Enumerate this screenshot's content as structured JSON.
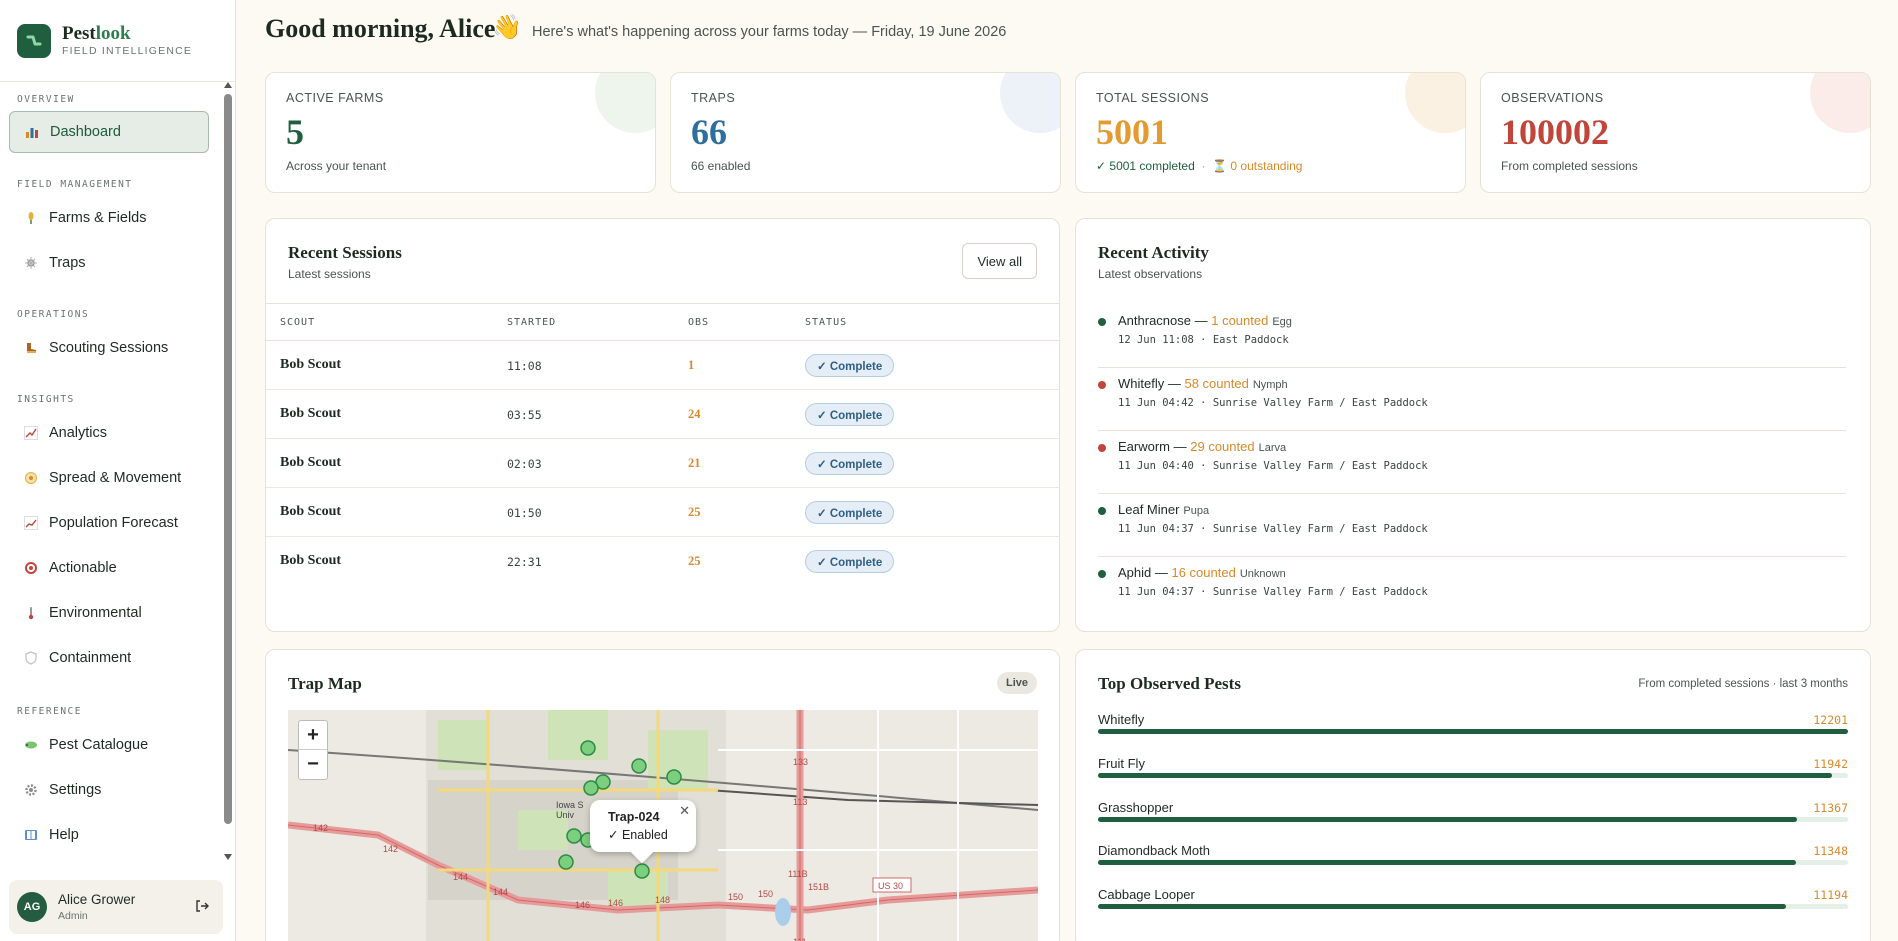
{
  "brand": {
    "name_prefix": "Pest",
    "name_suffix": "look",
    "subtitle": "FIELD INTELLIGENCE"
  },
  "sidebar": {
    "sections": [
      {
        "title": "OVERVIEW"
      },
      {
        "title": "FIELD MANAGEMENT"
      },
      {
        "title": "OPERATIONS"
      },
      {
        "title": "INSIGHTS"
      },
      {
        "title": "REFERENCE"
      }
    ],
    "items": [
      {
        "label": "Dashboard",
        "icon": "bar-chart-icon",
        "active": true
      },
      {
        "label": "Farms & Fields",
        "icon": "crop-icon"
      },
      {
        "label": "Traps",
        "icon": "trap-icon"
      },
      {
        "label": "Scouting Sessions",
        "icon": "boot-icon"
      },
      {
        "label": "Analytics",
        "icon": "line-chart-icon"
      },
      {
        "label": "Spread & Movement",
        "icon": "spread-icon"
      },
      {
        "label": "Population Forecast",
        "icon": "forecast-icon"
      },
      {
        "label": "Actionable",
        "icon": "target-icon"
      },
      {
        "label": "Environmental",
        "icon": "thermometer-icon"
      },
      {
        "label": "Containment",
        "icon": "shield-icon"
      },
      {
        "label": "Pest Catalogue",
        "icon": "bug-icon"
      },
      {
        "label": "Settings",
        "icon": "gear-icon"
      },
      {
        "label": "Help",
        "icon": "book-icon"
      }
    ]
  },
  "user": {
    "initials": "AG",
    "name": "Alice Grower",
    "role": "Admin"
  },
  "header": {
    "greeting": "Good morning, Alice",
    "wave": "👋",
    "subtitle": "Here's what's happening across your farms today — Friday, 19 June 2026"
  },
  "stats": [
    {
      "label": "ACTIVE FARMS",
      "value": "5",
      "sub": "Across your tenant",
      "color": "#1f5e3f"
    },
    {
      "label": "TRAPS",
      "value": "66",
      "sub": "66 enabled",
      "color": "#2e6f9e"
    },
    {
      "label": "TOTAL SESSIONS",
      "value": "5001",
      "sub_completed": "✓ 5001 completed",
      "sub_sep": "·",
      "sub_outstanding": "⏳ 0 outstanding",
      "color": "#e39a2f"
    },
    {
      "label": "OBSERVATIONS",
      "value": "100002",
      "sub": "From completed sessions",
      "color": "#c0453a"
    }
  ],
  "recent_sessions": {
    "title": "Recent Sessions",
    "subtitle": "Latest sessions",
    "view_all": "View all",
    "columns": [
      "SCOUT",
      "STARTED",
      "OBS",
      "STATUS"
    ],
    "rows": [
      {
        "scout": "Bob Scout",
        "started": "11:08",
        "obs": "1",
        "status": "✓ Complete"
      },
      {
        "scout": "Bob Scout",
        "started": "03:55",
        "obs": "24",
        "status": "✓ Complete"
      },
      {
        "scout": "Bob Scout",
        "started": "02:03",
        "obs": "21",
        "status": "✓ Complete"
      },
      {
        "scout": "Bob Scout",
        "started": "01:50",
        "obs": "25",
        "status": "✓ Complete"
      },
      {
        "scout": "Bob Scout",
        "started": "22:31",
        "obs": "25",
        "status": "✓ Complete"
      }
    ]
  },
  "recent_activity": {
    "title": "Recent Activity",
    "subtitle": "Latest observations",
    "items": [
      {
        "pest": "Anthracnose",
        "dash": " — ",
        "count": "1 counted",
        "stage": "Egg",
        "meta": "12 Jun 11:08 · East Paddock",
        "dot": "#1f5e3f"
      },
      {
        "pest": "Whitefly",
        "dash": " — ",
        "count": "58 counted",
        "stage": "Nymph",
        "meta": "11 Jun 04:42 · Sunrise Valley Farm / East Paddock",
        "dot": "#c0453a"
      },
      {
        "pest": "Earworm",
        "dash": " — ",
        "count": "29 counted",
        "stage": "Larva",
        "meta": "11 Jun 04:40 · Sunrise Valley Farm / East Paddock",
        "dot": "#c0453a"
      },
      {
        "pest": "Leaf Miner",
        "dash": "",
        "count": "",
        "stage": "Pupa",
        "meta": "11 Jun 04:37 · Sunrise Valley Farm / East Paddock",
        "dot": "#1f5e3f"
      },
      {
        "pest": "Aphid",
        "dash": " — ",
        "count": "16 counted",
        "stage": "Unknown",
        "meta": "11 Jun 04:37 · Sunrise Valley Farm / East Paddock",
        "dot": "#1f5e3f"
      }
    ]
  },
  "trap_map": {
    "title": "Trap Map",
    "badge": "Live",
    "zoom_in": "+",
    "zoom_out": "−",
    "popup": {
      "title": "Trap-024",
      "status": "✓ Enabled",
      "close": "✕"
    },
    "map_labels": [
      "142",
      "142",
      "144",
      "144",
      "146",
      "146",
      "148",
      "150",
      "150",
      "133",
      "113",
      "111",
      "151B",
      "111B",
      "US 30",
      "Iowa S",
      "Univ"
    ]
  },
  "top_pests": {
    "title": "Top Observed Pests",
    "note": "From completed sessions · last 3 months",
    "items": [
      {
        "name": "Whitefly",
        "value": "12201",
        "fraction": 1.0
      },
      {
        "name": "Fruit Fly",
        "value": "11942",
        "fraction": 0.979
      },
      {
        "name": "Grasshopper",
        "value": "11367",
        "fraction": 0.932
      },
      {
        "name": "Diamondback Moth",
        "value": "11348",
        "fraction": 0.93
      },
      {
        "name": "Cabbage Looper",
        "value": "11194",
        "fraction": 0.917
      }
    ]
  }
}
